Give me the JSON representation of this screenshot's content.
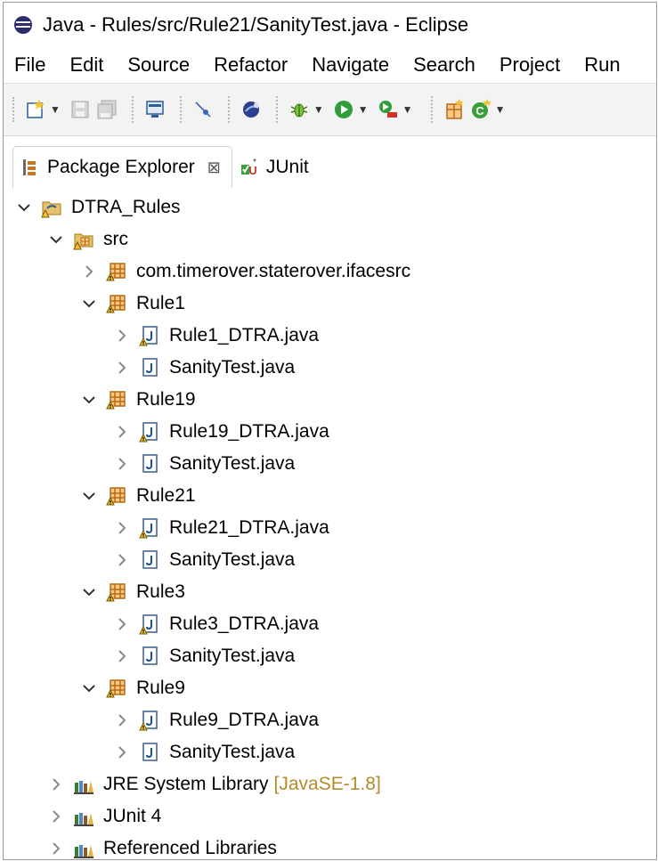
{
  "window": {
    "title": "Java - Rules/src/Rule21/SanityTest.java - Eclipse"
  },
  "menu": {
    "file": "File",
    "edit": "Edit",
    "source": "Source",
    "refactor": "Refactor",
    "navigate": "Navigate",
    "search": "Search",
    "project": "Project",
    "run": "Run"
  },
  "tabs": {
    "package_explorer": "Package Explorer",
    "close_glyph": "⊠",
    "junit": "JUnit"
  },
  "tree": {
    "project": "DTRA_Rules",
    "src": "src",
    "pkg_ifacesrc": "com.timerover.staterover.ifacesrc",
    "rule1": "Rule1",
    "rule1_dtra": "Rule1_DTRA.java",
    "rule1_sanity": "SanityTest.java",
    "rule19": "Rule19",
    "rule19_dtra": "Rule19_DTRA.java",
    "rule19_sanity": "SanityTest.java",
    "rule21": "Rule21",
    "rule21_dtra": "Rule21_DTRA.java",
    "rule21_sanity": "SanityTest.java",
    "rule3": "Rule3",
    "rule3_dtra": "Rule3_DTRA.java",
    "rule3_sanity": "SanityTest.java",
    "rule9": "Rule9",
    "rule9_dtra": "Rule9_DTRA.java",
    "rule9_sanity": "SanityTest.java",
    "jre_label": "JRE System Library",
    "jre_decoration": "[JavaSE-1.8]",
    "junit4": "JUnit 4",
    "ref_libs": "Referenced Libraries"
  },
  "colors": {
    "decoration": "#b58b2a",
    "package_icon": "#c8751c",
    "java_file_icon": "#2a5fa3"
  }
}
